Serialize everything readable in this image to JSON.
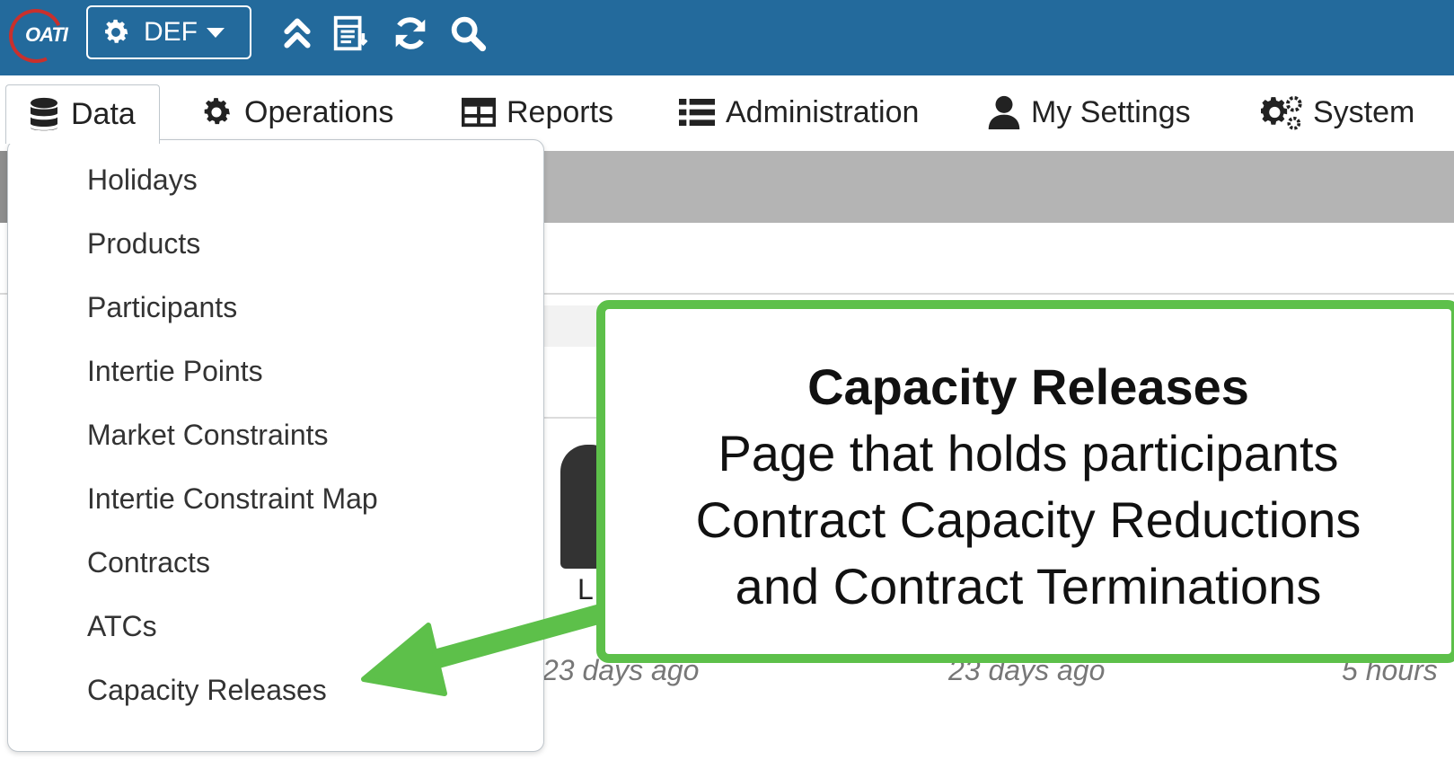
{
  "topbar": {
    "logo_text": "OATI",
    "environment": "DEF",
    "icons": [
      "gear-icon",
      "double-chevron-up-icon",
      "table-export-icon",
      "refresh-icon",
      "search-icon"
    ]
  },
  "nav": {
    "items": [
      {
        "label": "Data",
        "icon": "database-icon",
        "active": true
      },
      {
        "label": "Operations",
        "icon": "gear-icon"
      },
      {
        "label": "Reports",
        "icon": "table-icon"
      },
      {
        "label": "Administration",
        "icon": "list-icon"
      },
      {
        "label": "My Settings",
        "icon": "user-icon"
      },
      {
        "label": "System",
        "icon": "gears-icon"
      }
    ]
  },
  "dropdown": {
    "items": [
      "Holidays",
      "Products",
      "Participants",
      "Intertie Points",
      "Market Constraints",
      "Intertie Constraint Map",
      "Contracts",
      "ATCs",
      "Capacity Releases"
    ]
  },
  "background": {
    "tile_label": "L",
    "times": [
      "23 days ago",
      "23 days ago",
      "5 hours"
    ]
  },
  "callout": {
    "title": "Capacity Releases",
    "lines": [
      "Page that holds participants",
      "Contract Capacity Reductions",
      "and Contract Terminations"
    ]
  },
  "colors": {
    "topbar": "#236a9c",
    "callout_border": "#5dc04a",
    "band_gray": "#b4b4b4"
  }
}
